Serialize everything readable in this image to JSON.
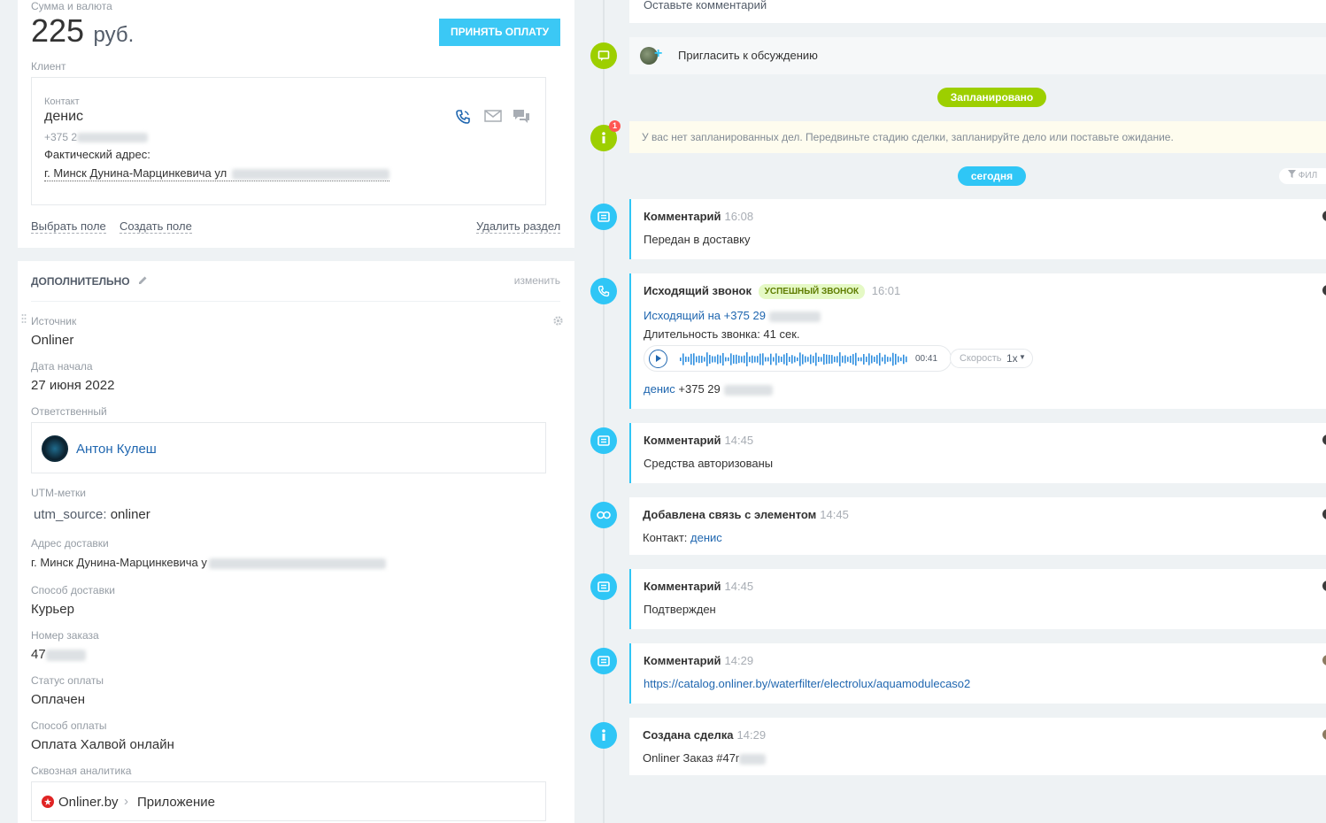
{
  "amount": {
    "label": "Сумма и валюта",
    "value": "225",
    "currency": "руб.",
    "pay_button": "ПРИНЯТЬ ОПЛАТУ"
  },
  "client": {
    "section_label": "Клиент",
    "contact_label": "Контакт",
    "contact_name": "денис",
    "phone_prefix": "+375 2",
    "address_label": "Фактический адрес:",
    "address_value": "г. Минск Дунина-Марцинкевича ул",
    "links": {
      "choose_field": "Выбрать поле",
      "create_field": "Создать поле",
      "delete_section": "Удалить раздел"
    }
  },
  "extra": {
    "title": "ДОПОЛНИТЕЛЬНО",
    "edit": "изменить",
    "fields": {
      "source_label": "Источник",
      "source_value": "Onliner",
      "start_label": "Дата начала",
      "start_value": "27 июня 2022",
      "resp_label": "Ответственный",
      "resp_value": "Антон Кулеш",
      "utm_label": "UTM-метки",
      "utm_key": "utm_source:",
      "utm_value": "onliner",
      "delivery_addr_label": "Адрес доставки",
      "delivery_addr_value": "г. Минск Дунина-Марцинкевича у",
      "delivery_method_label": "Способ доставки",
      "delivery_method_value": "Курьер",
      "order_label": "Номер заказа",
      "order_value": "47",
      "pay_status_label": "Статус оплаты",
      "pay_status_value": "Оплачен",
      "pay_method_label": "Способ оплаты",
      "pay_method_value": "Оплата Халвой онлайн",
      "analytics_label": "Сквозная аналитика",
      "analytics_source": "Onliner.by",
      "analytics_channel": "Приложение"
    }
  },
  "timeline": {
    "comment_placeholder": "Оставьте комментарий",
    "invite": "Пригласить к обсуждению",
    "planned_pill": "Запланировано",
    "notice_badge": "1",
    "notice": "У вас нет запланированных дел. Передвиньте стадию сделки, запланируйте дело или поставьте ожидание.",
    "today_pill": "сегодня",
    "filter": "ФИЛ",
    "items": [
      {
        "title": "Комментарий",
        "time": "16:08",
        "text": "Передан в доставку"
      },
      {
        "title": "Исходящий звонок",
        "badge": "УСПЕШНЫЙ ЗВОНОК",
        "time": "16:01",
        "to_label": "Исходящий на +375 29",
        "duration": "Длительность звонка: 41 сек.",
        "audio_time": "00:41",
        "speed_label": "Скорость",
        "speed_value": "1x",
        "contact": "денис",
        "contact_phone": "+375 29"
      },
      {
        "title": "Комментарий",
        "time": "14:45",
        "text": "Средства авторизованы"
      },
      {
        "title": "Добавлена связь с элементом",
        "time": "14:45",
        "text_label": "Контакт:",
        "text_link": "денис"
      },
      {
        "title": "Комментарий",
        "time": "14:45",
        "text": "Подтвержден"
      },
      {
        "title": "Комментарий",
        "time": "14:29",
        "link": "https://catalog.onliner.by/waterfilter/electrolux/aquamodulecaso2"
      },
      {
        "title": "Создана сделка",
        "time": "14:29",
        "text": "Onliner Заказ #47r"
      }
    ]
  },
  "colors": {
    "accent": "#2fc6f6",
    "green": "#9dcf00",
    "link": "#2067b0",
    "pay": "#3bc8f5"
  }
}
